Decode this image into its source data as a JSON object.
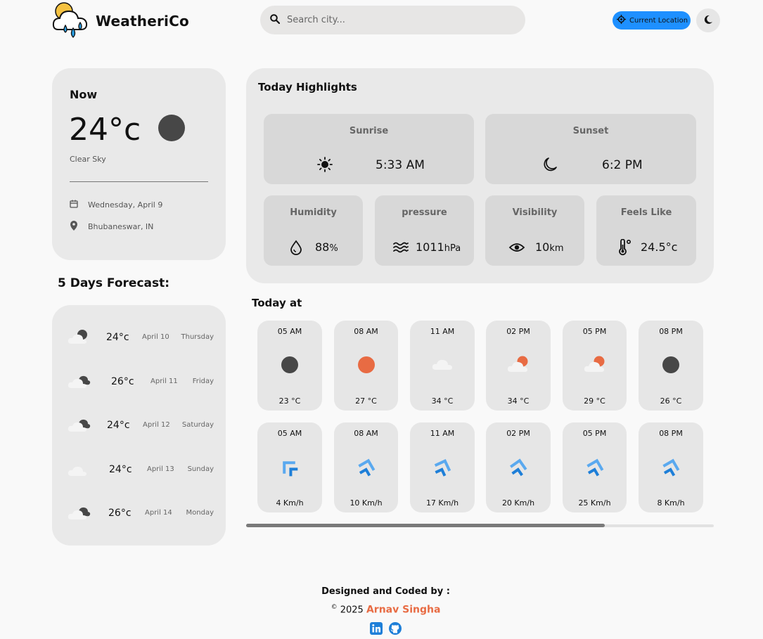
{
  "app": {
    "name": "WeatheriCo",
    "search_placeholder": "Search city...",
    "current_location_label": "Current Location"
  },
  "now": {
    "title": "Now",
    "temp": "24°c",
    "description": "Clear Sky",
    "date": "Wednesday, April 9",
    "location": "Bhubaneswar, IN",
    "icon": "moon-dark-icon"
  },
  "forecast": {
    "heading": "5 Days Forecast:",
    "days": [
      {
        "temp": "24°c",
        "date": "April 10",
        "day": "Thursday",
        "icon": "partly-cloudy-night-icon"
      },
      {
        "temp": "26°c",
        "date": "April 11",
        "day": "Friday",
        "icon": "cloudy-icon"
      },
      {
        "temp": "24°c",
        "date": "April 12",
        "day": "Saturday",
        "icon": "cloudy-icon"
      },
      {
        "temp": "24°c",
        "date": "April 13",
        "day": "Sunday",
        "icon": "cloud-icon"
      },
      {
        "temp": "26°c",
        "date": "April 14",
        "day": "Monday",
        "icon": "cloudy-icon"
      }
    ]
  },
  "highlights": {
    "title": "Today Highlights",
    "sunrise": {
      "label": "Sunrise",
      "value": "5:33 AM"
    },
    "sunset": {
      "label": "Sunset",
      "value": "6:2 PM"
    },
    "humidity": {
      "label": "Humidity",
      "value": "88",
      "unit": "%"
    },
    "pressure": {
      "label": "pressure",
      "value": "1011",
      "unit": "hPa"
    },
    "visibility": {
      "label": "Visibility",
      "value": "10",
      "unit": "km"
    },
    "feels_like": {
      "label": "Feels Like",
      "value": "24.5°c"
    }
  },
  "today_at": {
    "heading": "Today at",
    "temps": [
      {
        "time": "05 AM",
        "value": "23 °C",
        "icon": "moon-dark-icon"
      },
      {
        "time": "08 AM",
        "value": "27 °C",
        "icon": "sun-orange-icon"
      },
      {
        "time": "11 AM",
        "value": "34 °C",
        "icon": "cloud-icon"
      },
      {
        "time": "02 PM",
        "value": "34 °C",
        "icon": "partly-cloudy-day-icon"
      },
      {
        "time": "05 PM",
        "value": "29 °C",
        "icon": "partly-cloudy-day-icon"
      },
      {
        "time": "08 PM",
        "value": "26 °C",
        "icon": "moon-dark-icon"
      }
    ],
    "winds": [
      {
        "time": "05 AM",
        "value": "4 Km/h",
        "icon": "wind-direction-icon"
      },
      {
        "time": "08 AM",
        "value": "10 Km/h",
        "icon": "wind-direction-icon"
      },
      {
        "time": "11 AM",
        "value": "17 Km/h",
        "icon": "wind-direction-icon"
      },
      {
        "time": "02 PM",
        "value": "20 Km/h",
        "icon": "wind-direction-icon"
      },
      {
        "time": "05 PM",
        "value": "25 Km/h",
        "icon": "wind-direction-icon"
      },
      {
        "time": "08 PM",
        "value": "8 Km/h",
        "icon": "wind-direction-icon"
      }
    ]
  },
  "footer": {
    "designed_by": "Designed and Coded by :",
    "copyright": "©",
    "year": "2025",
    "author": "Arnav Singha"
  },
  "colors": {
    "accent": "#1e90ff",
    "author": "#e86b43",
    "sun": "#e86b43",
    "moon": "#474747"
  }
}
